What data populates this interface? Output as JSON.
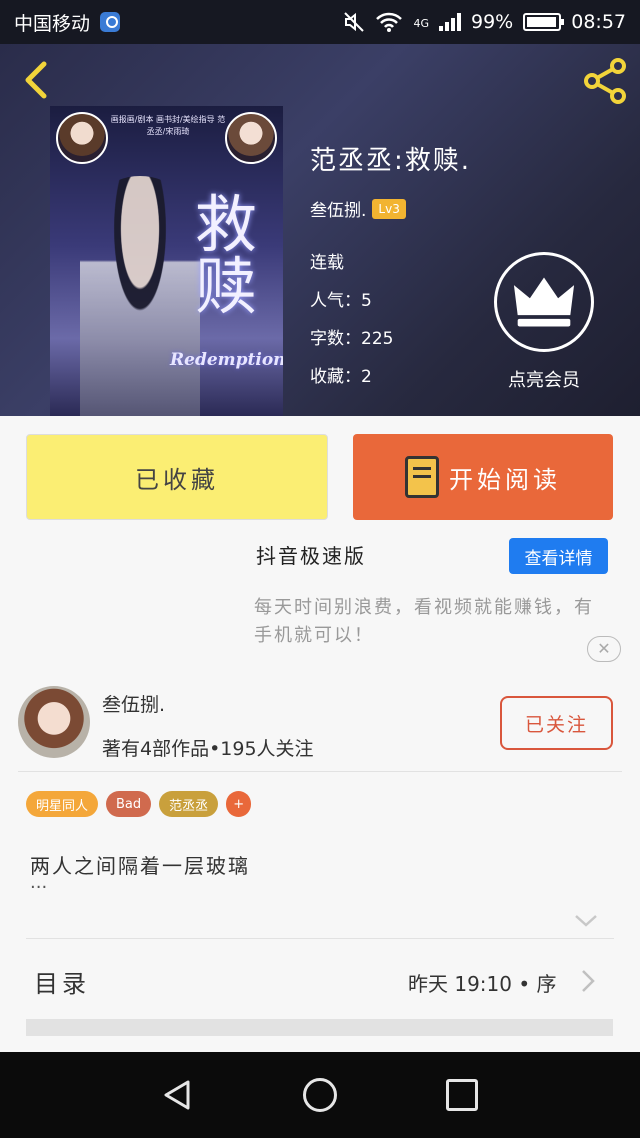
{
  "status_bar": {
    "carrier": "中国移动",
    "network": "4G",
    "battery": "99%",
    "time": "08:57"
  },
  "header": {
    "back_icon": "chevron-left-icon",
    "share_icon": "share-icon"
  },
  "book": {
    "cover_credits": "画报画/剧本 画书封/美绘指导 范丞丞/宋雨琦",
    "cover_title": "救赎",
    "cover_subtitle": "Redemption",
    "title": "范丞丞:救赎.",
    "author": "叁伍捌.",
    "author_level": "Lv3",
    "status": "连载",
    "popularity": "人气：5",
    "word_count": "字数：225",
    "favorites": "收藏：2"
  },
  "vip": {
    "icon": "crown-icon",
    "label": "点亮会员"
  },
  "actions": {
    "collected_label": "已收藏",
    "read_label": "开始阅读",
    "read_icon": "book-icon"
  },
  "ad": {
    "title": "抖音极速版",
    "button": "查看详情",
    "desc": "每天时间别浪费，看视频就能赚钱，有手机就可以！",
    "close": "✕"
  },
  "author_card": {
    "name": "叁伍捌.",
    "stats": "著有4部作品•195人关注",
    "follow_label": "已关注"
  },
  "tags": [
    {
      "label": "明星同人",
      "color": "#f4a73a"
    },
    {
      "label": "Bad",
      "color": "#d06a4e"
    },
    {
      "label": "范丞丞",
      "color": "#c9a03c"
    },
    {
      "label": "+",
      "color": "#e9683a"
    }
  ],
  "summary": {
    "text": "两人之间隔着一层玻璃",
    "ellipsis": "..."
  },
  "toc": {
    "label": "目录",
    "latest": "昨天 19:10 • 序"
  },
  "colors": {
    "accent_orange": "#e9683a",
    "collected_yellow": "#fbee73",
    "ad_blue": "#1f7cf0",
    "follow_red": "#d9563c"
  }
}
